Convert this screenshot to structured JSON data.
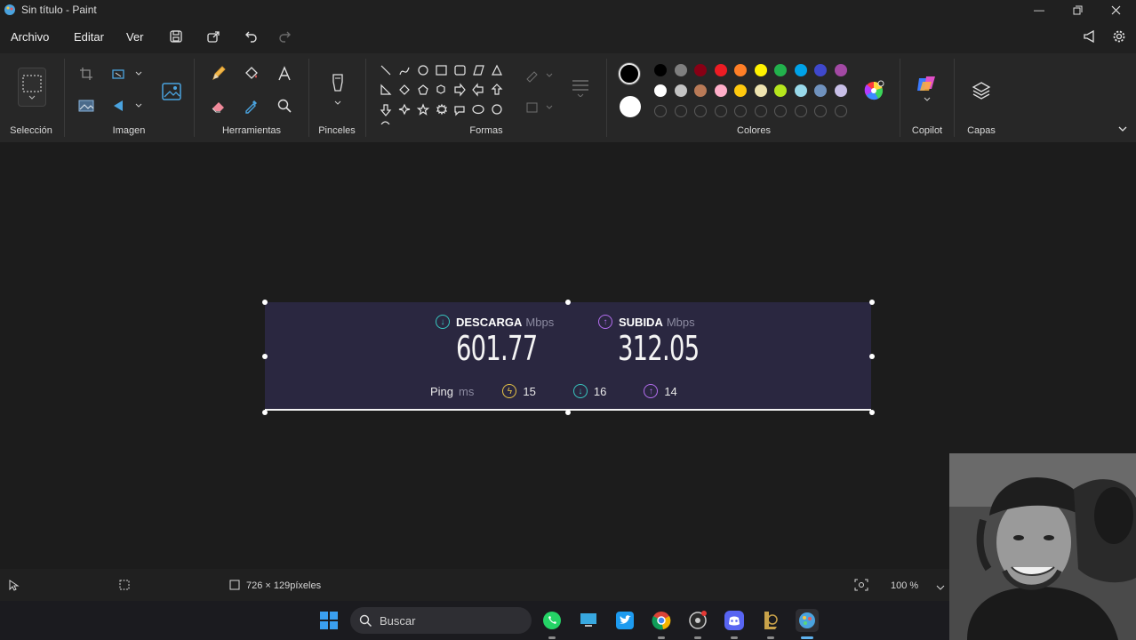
{
  "window": {
    "title": "Sin título - Paint"
  },
  "menu": {
    "archivo": "Archivo",
    "editar": "Editar",
    "ver": "Ver"
  },
  "ribbon": {
    "groups": {
      "seleccion": "Selección",
      "imagen": "Imagen",
      "herramientas": "Herramientas",
      "pinceles": "Pinceles",
      "formas": "Formas",
      "colores": "Colores",
      "copilot": "Copilot",
      "capas": "Capas"
    },
    "color_rows": [
      [
        "#000000",
        "#7f7f7f",
        "#880015",
        "#ed1c24",
        "#ff7f27",
        "#fff200",
        "#22b14c",
        "#00a2e8",
        "#3f48cc",
        "#a349a4"
      ],
      [
        "#ffffff",
        "#c3c3c3",
        "#b97a57",
        "#ffaec9",
        "#ffc90e",
        "#efe4b0",
        "#b5e61d",
        "#99d9ea",
        "#7092be",
        "#c8bfe7"
      ]
    ],
    "primary_color": "#000000",
    "secondary_color": "#ffffff"
  },
  "speedtest": {
    "download_label": "DESCARGA",
    "download_unit": "Mbps",
    "download_value": "601.77",
    "upload_label": "SUBIDA",
    "upload_unit": "Mbps",
    "upload_value": "312.05",
    "ping_label": "Ping",
    "ping_unit": "ms",
    "ping_idle": "15",
    "ping_download": "16",
    "ping_upload": "14"
  },
  "status": {
    "dimensions": "726 × 129píxeles",
    "zoom": "100 %"
  },
  "taskbar": {
    "search_placeholder": "Buscar"
  },
  "colors": {
    "download_accent": "#38c7c0",
    "upload_accent": "#b46ef0",
    "ping_accent": "#e8c547"
  }
}
